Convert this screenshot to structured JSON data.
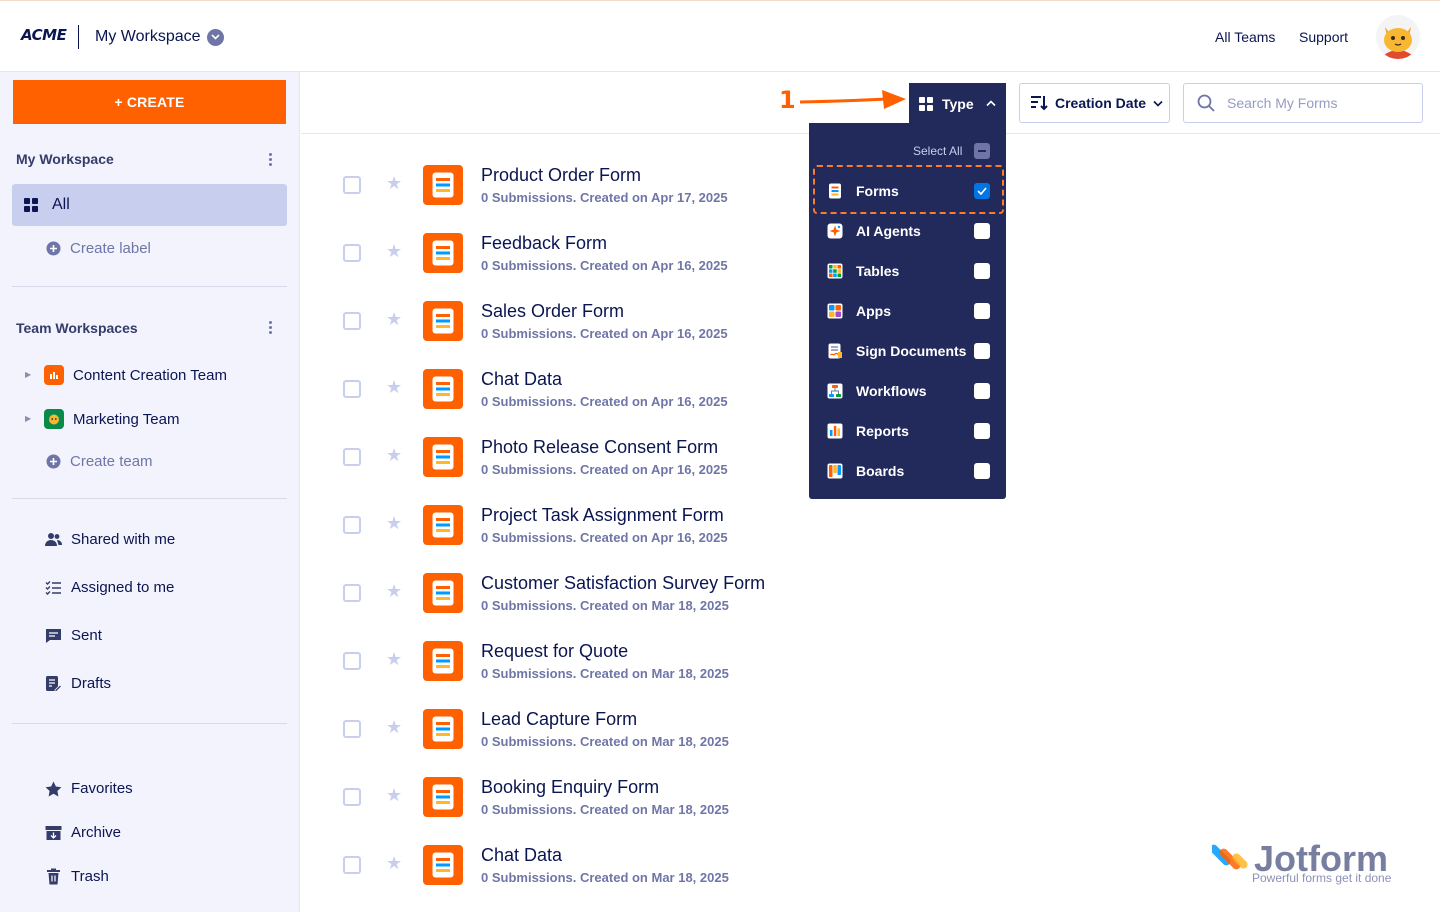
{
  "header": {
    "logo": "ACME",
    "workspace_title": "My Workspace",
    "all_teams": "All Teams",
    "support": "Support"
  },
  "sidebar": {
    "create_label": "+ CREATE",
    "my_workspace_heading": "My Workspace",
    "all_label": "All",
    "create_label_link": "Create label",
    "team_workspaces_heading": "Team Workspaces",
    "teams": [
      {
        "name": "Content Creation Team",
        "color": "#ff6100"
      },
      {
        "name": "Marketing Team",
        "color": "#0a8a4a"
      }
    ],
    "create_team": "Create team",
    "nav": [
      {
        "label": "Shared with me",
        "icon": "users-icon"
      },
      {
        "label": "Assigned to me",
        "icon": "checklist-icon"
      },
      {
        "label": "Sent",
        "icon": "message-icon"
      },
      {
        "label": "Drafts",
        "icon": "draft-icon"
      }
    ],
    "bottom": [
      {
        "label": "Favorites",
        "icon": "star-icon"
      },
      {
        "label": "Archive",
        "icon": "archive-icon"
      },
      {
        "label": "Trash",
        "icon": "trash-icon"
      }
    ]
  },
  "toolbar": {
    "type_label": "Type",
    "sort_label": "Creation Date",
    "search_placeholder": "Search My Forms",
    "annotation_number": "1"
  },
  "type_dropdown": {
    "select_all": "Select All",
    "items": [
      {
        "label": "Forms",
        "checked": true
      },
      {
        "label": "AI Agents",
        "checked": false
      },
      {
        "label": "Tables",
        "checked": false
      },
      {
        "label": "Apps",
        "checked": false
      },
      {
        "label": "Sign Documents",
        "checked": false
      },
      {
        "label": "Workflows",
        "checked": false
      },
      {
        "label": "Reports",
        "checked": false
      },
      {
        "label": "Boards",
        "checked": false
      }
    ]
  },
  "forms": [
    {
      "title": "Product Order Form",
      "meta": "0 Submissions. Created on Apr 17, 2025"
    },
    {
      "title": "Feedback Form",
      "meta": "0 Submissions. Created on Apr 16, 2025"
    },
    {
      "title": "Sales Order Form",
      "meta": "0 Submissions. Created on Apr 16, 2025"
    },
    {
      "title": "Chat Data",
      "meta": "0 Submissions. Created on Apr 16, 2025"
    },
    {
      "title": "Photo Release Consent Form",
      "meta": "0 Submissions. Created on Apr 16, 2025"
    },
    {
      "title": "Project Task Assignment Form",
      "meta": "0 Submissions. Created on Apr 16, 2025"
    },
    {
      "title": "Customer Satisfaction Survey Form",
      "meta": "0 Submissions. Created on Mar 18, 2025"
    },
    {
      "title": "Request for Quote",
      "meta": "0 Submissions. Created on Mar 18, 2025"
    },
    {
      "title": "Lead Capture Form",
      "meta": "0 Submissions. Created on Mar 18, 2025"
    },
    {
      "title": "Booking Enquiry Form",
      "meta": "0 Submissions. Created on Mar 18, 2025"
    },
    {
      "title": "Chat Data",
      "meta": "0 Submissions. Created on Mar 18, 2025"
    }
  ],
  "watermark": {
    "brand": "Jotform",
    "tagline": "Powerful forms get it done"
  },
  "colors": {
    "accent": "#ff6100",
    "navy": "#0a1551",
    "dropdown_bg": "#222a5b",
    "checkbox_on": "#0075e3"
  }
}
